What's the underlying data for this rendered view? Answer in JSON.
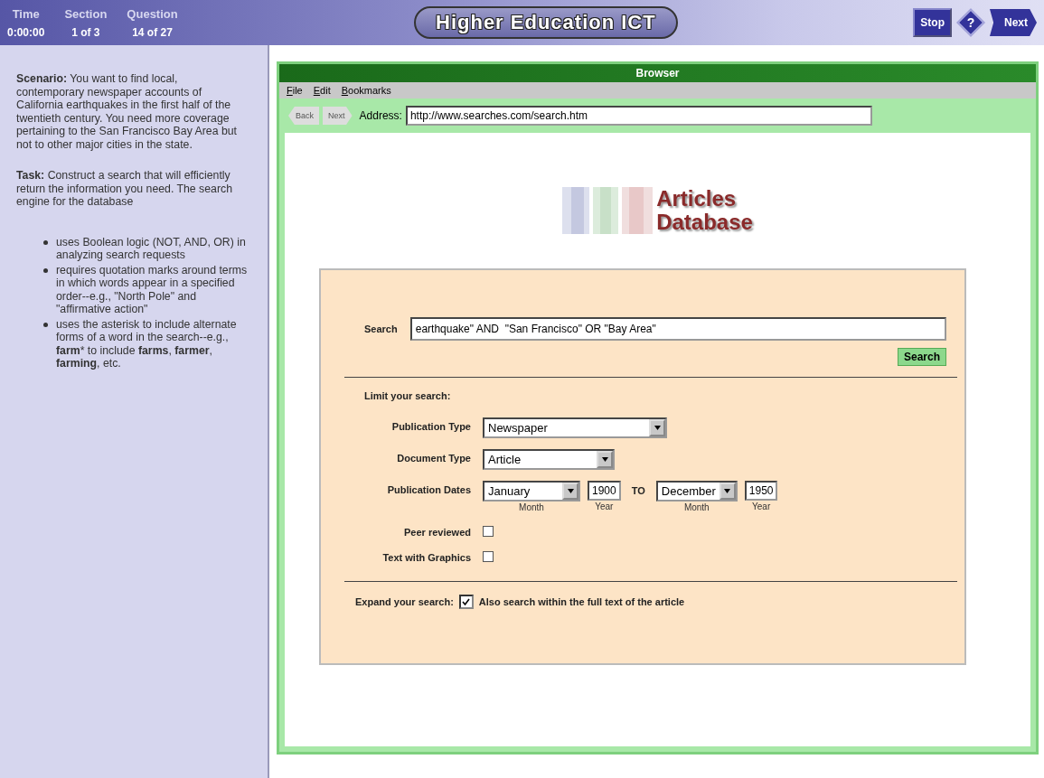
{
  "header": {
    "stats": [
      {
        "label": "Time",
        "value": "0:00:00"
      },
      {
        "label": "Section",
        "value": "1 of 3"
      },
      {
        "label": "Question",
        "value": "14 of 27"
      }
    ],
    "title": "Higher Education ICT",
    "buttons": [
      {
        "kind": "stop",
        "label": "Stop"
      },
      {
        "kind": "help",
        "label": "?"
      },
      {
        "kind": "next",
        "label": "Next"
      }
    ]
  },
  "sidebar": {
    "paragraphs": [
      "**Scenario:** You want to find local, contemporary newspaper accounts of California earthquakes in the first half of the twentieth century. You need more coverage pertaining to the San Francisco Bay Area but not to other major cities in the state.",
      "**Task:** Construct a search that will efficiently return the information you need. The search engine for the database"
    ],
    "bullets": [
      "uses Boolean logic (NOT, AND, OR) in analyzing search requests",
      "requires quotation marks around terms in which words appear in a specified order--e.g., \"North Pole\" and \"affirmative action\"",
      "uses the asterisk to include alternate forms of a word in the search--e.g., **farm*** to include **farms**, **farmer**, **farming**, etc."
    ]
  },
  "browser": {
    "title": "Browser",
    "menu": [
      "File",
      "Edit",
      "Bookmarks"
    ],
    "nav": [
      {
        "kind": "back",
        "label": "Back"
      },
      {
        "kind": "next",
        "label": "Next"
      }
    ],
    "address_label": "Address:",
    "address": "http://www.searches.com/search.htm",
    "logo": [
      "Articles",
      "Database"
    ],
    "form": {
      "search_label": "Search",
      "search_value": "earthquake\" AND  \"San Francisco\" OR \"Bay Area\"",
      "search_button": "Search",
      "limit_heading": "Limit your search:",
      "limits": [
        {
          "kind": "select",
          "label": "Publication Type",
          "value": "Newspaper"
        },
        {
          "kind": "select",
          "label": "Document Type",
          "value": "Article"
        },
        {
          "kind": "dates",
          "label": "Publication Dates",
          "from_month": "January",
          "from_month_caption": "Month",
          "from_year": "1900",
          "from_year_caption": "Year",
          "joiner": "TO",
          "to_month": "December",
          "to_month_caption": "Month",
          "to_year": "1950",
          "to_year_caption": "Year"
        },
        {
          "kind": "checkbox",
          "label": "Peer reviewed",
          "checked": false
        },
        {
          "kind": "checkbox",
          "label": "Text with Graphics",
          "checked": false
        }
      ],
      "expand_label": "Expand your search:",
      "expand_option": "Also search within the full text of the article",
      "expand_checked": true
    }
  }
}
